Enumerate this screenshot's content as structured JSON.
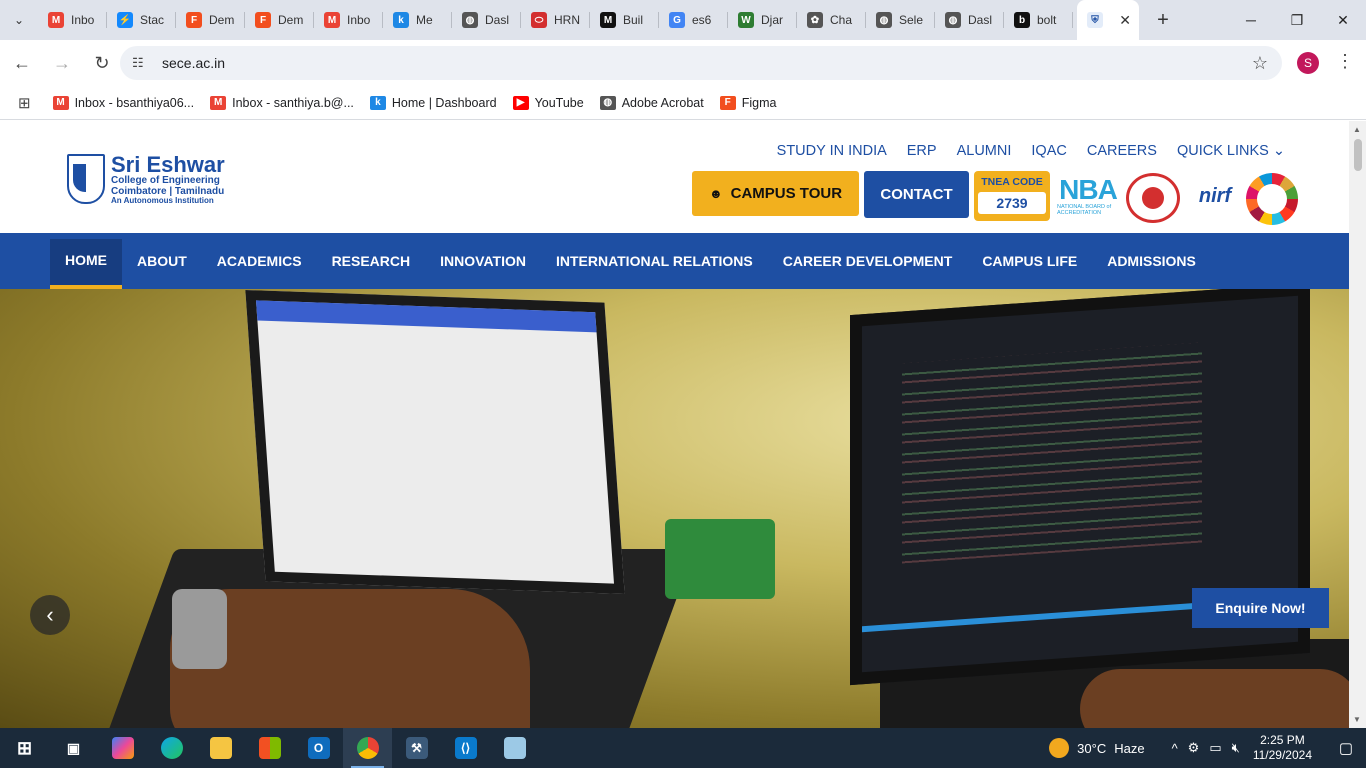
{
  "browser": {
    "tabs": [
      {
        "label": "Inbo",
        "icon": "gmail-icon",
        "color": "#ea4335",
        "glyph": "M"
      },
      {
        "label": "Stac",
        "icon": "stackblitz-icon",
        "color": "#1389fd",
        "glyph": "⚡"
      },
      {
        "label": "Dem",
        "icon": "figma-icon",
        "color": "#f24e1e",
        "glyph": "F"
      },
      {
        "label": "Dem",
        "icon": "figma-icon",
        "color": "#f24e1e",
        "glyph": "F"
      },
      {
        "label": "Inbo",
        "icon": "gmail-icon",
        "color": "#ea4335",
        "glyph": "M"
      },
      {
        "label": "Me",
        "icon": "k-icon",
        "color": "#1e88e5",
        "glyph": "k"
      },
      {
        "label": "Dasl",
        "icon": "globe-icon",
        "color": "#555555",
        "glyph": "◍"
      },
      {
        "label": "HRN",
        "icon": "oracle-icon",
        "color": "#d32f2f",
        "glyph": "⬭"
      },
      {
        "label": "Buil",
        "icon": "m-icon",
        "color": "#111111",
        "glyph": "M"
      },
      {
        "label": "es6",
        "icon": "google-icon",
        "color": "#4285f4",
        "glyph": "G"
      },
      {
        "label": "Djar",
        "icon": "w-icon",
        "color": "#2e7d32",
        "glyph": "W"
      },
      {
        "label": "Cha",
        "icon": "chatgpt-icon",
        "color": "#555555",
        "glyph": "✿"
      },
      {
        "label": "Sele",
        "icon": "globe-icon",
        "color": "#555555",
        "glyph": "◍"
      },
      {
        "label": "Dasl",
        "icon": "globe-icon",
        "color": "#555555",
        "glyph": "◍"
      },
      {
        "label": "bolt",
        "icon": "bolt-icon",
        "color": "#111111",
        "glyph": "b"
      }
    ],
    "url": "sece.ac.in",
    "profile_initial": "S",
    "bookmarks": [
      {
        "label": "Inbox - bsanthiya06...",
        "icon": "gmail-icon",
        "color": "#ea4335",
        "glyph": "M"
      },
      {
        "label": "Inbox - santhiya.b@...",
        "icon": "gmail-icon",
        "color": "#ea4335",
        "glyph": "M"
      },
      {
        "label": "Home | Dashboard",
        "icon": "k-icon",
        "color": "#1e88e5",
        "glyph": "k"
      },
      {
        "label": "YouTube",
        "icon": "youtube-icon",
        "color": "#ff0000",
        "glyph": "▶"
      },
      {
        "label": "Adobe Acrobat",
        "icon": "globe-icon",
        "color": "#555555",
        "glyph": "◍"
      },
      {
        "label": "Figma",
        "icon": "figma-icon",
        "color": "#f24e1e",
        "glyph": "F"
      }
    ]
  },
  "site": {
    "logo_name": "Sri Eshwar",
    "logo_sub": "College of Engineering",
    "logo_sub2": "Coimbatore | Tamilnadu",
    "logo_sub3": "An Autonomous Institution",
    "top_links": [
      "STUDY IN INDIA",
      "ERP",
      "ALUMNI",
      "IQAC",
      "CAREERS",
      "QUICK LINKS"
    ],
    "campus_tour": "CAMPUS TOUR",
    "contact": "CONTACT",
    "tnea_label": "TNEA CODE",
    "tnea_code": "2739",
    "nba_big": "NBA",
    "nba_small": "NATIONAL BOARD of ACCREDITATION",
    "nirf": "nirf",
    "nav": [
      "HOME",
      "ABOUT",
      "ACADEMICS",
      "RESEARCH",
      "INNOVATION",
      "INTERNATIONAL RELATIONS",
      "CAREER DEVELOPMENT",
      "CAMPUS LIFE",
      "ADMISSIONS"
    ],
    "enquire": "Enquire Now!"
  },
  "taskbar": {
    "weather_temp": "30°C",
    "weather_desc": "Haze",
    "time": "2:25 PM",
    "date": "11/29/2024"
  },
  "colors": {
    "brand_blue": "#1e4fa3",
    "brand_yellow": "#f2b01e"
  }
}
